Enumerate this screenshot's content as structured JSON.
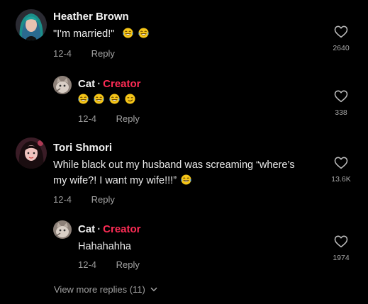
{
  "comments": [
    {
      "author": "Heather Brown",
      "text": "\"I'm married!\"",
      "emojis": [
        "laughing-emoji",
        "laughing-emoji"
      ],
      "date": "12-4",
      "reply_label": "Reply",
      "likes": "2640",
      "avatar": "teal-hair-avatar"
    },
    {
      "author": "Cat",
      "separator": "·",
      "badge": "Creator",
      "emojis": [
        "laughing-emoji",
        "laughing-emoji",
        "laughing-emoji",
        "smirk-emoji"
      ],
      "date": "12-4",
      "reply_label": "Reply",
      "likes": "338",
      "avatar": "cat-avatar"
    },
    {
      "author": "Tori Shmori",
      "text_line1": "While black out my husband was screaming “where’s",
      "text_line2": "my wife?! I want my wife!!!”",
      "emojis": [
        "laughing-emoji"
      ],
      "date": "12-4",
      "reply_label": "Reply",
      "likes": "13.6K",
      "avatar": "dark-hair-avatar"
    },
    {
      "author": "Cat",
      "separator": "·",
      "badge": "Creator",
      "text": "Hahahahha",
      "date": "12-4",
      "reply_label": "Reply",
      "likes": "1974",
      "avatar": "cat-avatar"
    }
  ],
  "view_more": "View more replies (11)",
  "colors": {
    "background": "#000000",
    "creator_badge": "#fe2c55",
    "meta_text": "#9a9a9a",
    "emoji_yellow": "#f5c518"
  }
}
